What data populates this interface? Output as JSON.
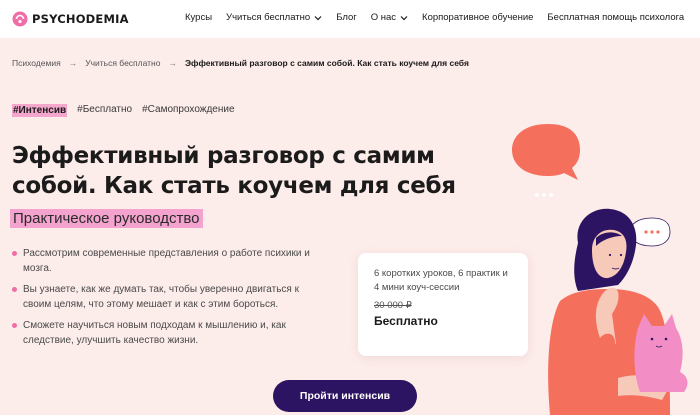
{
  "header": {
    "logo_text": "PSYCHODEMIA",
    "nav": [
      {
        "label": "Курсы",
        "has_dropdown": false
      },
      {
        "label": "Учиться бесплатно",
        "has_dropdown": true
      },
      {
        "label": "Блог",
        "has_dropdown": false
      },
      {
        "label": "О нас",
        "has_dropdown": true
      },
      {
        "label": "Корпоративное обучение",
        "has_dropdown": false
      },
      {
        "label": "Бесплатная помощь психолога",
        "has_dropdown": false
      }
    ]
  },
  "breadcrumb": {
    "items": [
      "Психодемия",
      "Учиться бесплатно",
      "Эффективный разговор с самим собой. Как стать коучем для себя"
    ],
    "separator": "→"
  },
  "tags": [
    "#Интенсив",
    "#Бесплатно",
    "#Самопрохождение"
  ],
  "hero": {
    "title": "Эффективный разговор с самим собой. Как стать коучем для себя",
    "subtitle": "Практическое руководство",
    "bullets": [
      "Рассмотрим современные представления о работе психики и мозга.",
      "Вы узнаете, как же думать так, чтобы уверенно двигаться к своим целям, что этому мешает и как с этим бороться.",
      "Сможете научиться новым подходам к мышлению и, как следствие, улучшить качество жизни."
    ]
  },
  "card": {
    "description": "6 коротких уроков, 6 практик и 4 мини коуч-сессии",
    "old_price": "30 000 ₽",
    "price": "Бесплатно"
  },
  "cta_label": "Пройти интенсив",
  "colors": {
    "hero_bg": "#fcecea",
    "accent_pink": "#f3a3ce",
    "bullet_dot": "#f06da8",
    "cta_bg": "#2d1462",
    "illustration_coral": "#f56f5d",
    "illustration_navy": "#2d1462"
  },
  "icons": [
    "psychodemia-logo-icon",
    "chevron-down-icon",
    "speech-bubble-icon",
    "woman-illustration",
    "cat-illustration"
  ]
}
